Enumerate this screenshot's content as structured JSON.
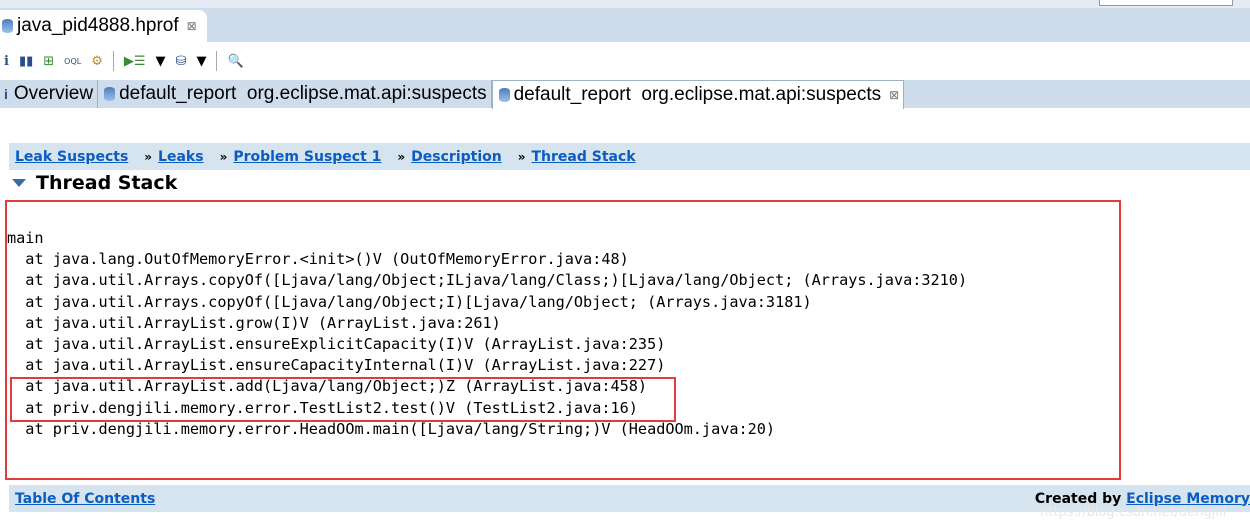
{
  "editor_tab": {
    "title": "java_pid4888.hprof",
    "close": "⊠"
  },
  "toolbar": {
    "icons": [
      "info-icon",
      "histogram-icon",
      "dominator-tree-icon",
      "oql-icon",
      "heap-dump-overview-icon",
      "run-report-icon",
      "dropdown-icon",
      "query-browser-icon",
      "dropdown-icon",
      "search-icon"
    ]
  },
  "report_tabs": [
    {
      "label": "Overview"
    },
    {
      "label": "default_report  org.eclipse.mat.api:suspects"
    },
    {
      "label": "default_report  org.eclipse.mat.api:suspects",
      "close": "⊠"
    }
  ],
  "breadcrumb": [
    "Leak Suspects",
    "Leaks",
    "Problem Suspect 1",
    "Description",
    "Thread Stack"
  ],
  "breadcrumb_sep": "»",
  "section_title": "Thread Stack",
  "stack": {
    "thread": "main",
    "frames": [
      "at java.lang.OutOfMemoryError.<init>()V (OutOfMemoryError.java:48)",
      "at java.util.Arrays.copyOf([Ljava/lang/Object;ILjava/lang/Class;)[Ljava/lang/Object; (Arrays.java:3210)",
      "at java.util.Arrays.copyOf([Ljava/lang/Object;I)[Ljava/lang/Object; (Arrays.java:3181)",
      "at java.util.ArrayList.grow(I)V (ArrayList.java:261)",
      "at java.util.ArrayList.ensureExplicitCapacity(I)V (ArrayList.java:235)",
      "at java.util.ArrayList.ensureCapacityInternal(I)V (ArrayList.java:227)",
      "at java.util.ArrayList.add(Ljava/lang/Object;)Z (ArrayList.java:458)",
      "at priv.dengjili.memory.error.TestList2.test()V (TestList2.java:16)",
      "at priv.dengjili.memory.error.HeadOOm.main([Ljava/lang/String;)V (HeadOOm.java:20)"
    ]
  },
  "footer": {
    "toc": "Table Of Contents",
    "created_by": "Created by",
    "link": "Eclipse Memory"
  },
  "watermark": "https://blog.csdn.net/dengjili",
  "colors": {
    "highlight_box": "#e23b3b",
    "link": "#0b5cc1",
    "bar": "#d6e4f0"
  }
}
